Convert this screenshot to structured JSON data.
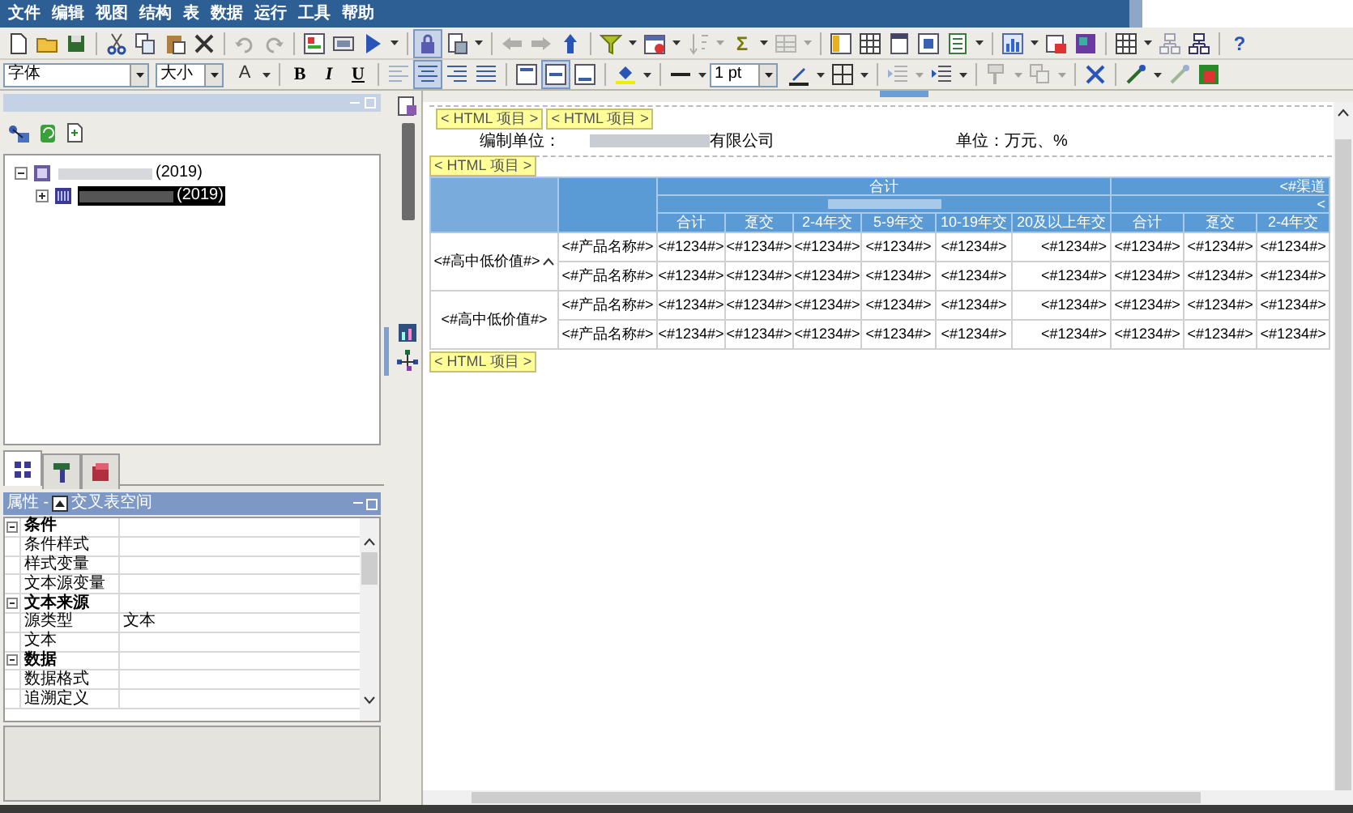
{
  "menu": [
    "文件",
    "编辑",
    "视图",
    "结构",
    "表",
    "数据",
    "运行",
    "工具",
    "帮助"
  ],
  "toolbar_1": [
    {
      "kind": "new",
      "pressed": false,
      "disabled": false
    },
    {
      "kind": "open",
      "pressed": false,
      "disabled": false
    },
    {
      "kind": "save",
      "pressed": false,
      "disabled": false
    },
    {
      "kind": "separator"
    },
    {
      "kind": "cut",
      "pressed": false,
      "disabled": false
    },
    {
      "kind": "copy",
      "pressed": false,
      "disabled": false
    },
    {
      "kind": "paste",
      "pressed": false,
      "disabled": false
    },
    {
      "kind": "delete",
      "pressed": false,
      "disabled": false
    },
    {
      "kind": "separator"
    },
    {
      "kind": "undo",
      "pressed": false,
      "disabled": true
    },
    {
      "kind": "redo",
      "pressed": false,
      "disabled": true
    },
    {
      "kind": "separator"
    },
    {
      "kind": "form",
      "pressed": false,
      "disabled": false
    },
    {
      "kind": "html",
      "pressed": false,
      "disabled": false
    },
    {
      "kind": "run",
      "pressed": false,
      "disabled": false
    },
    {
      "kind": "caret",
      "pressed": false,
      "disabled": false
    },
    {
      "kind": "separator"
    },
    {
      "kind": "lock",
      "pressed": true,
      "disabled": false
    },
    {
      "kind": "page",
      "pressed": false,
      "disabled": false
    },
    {
      "kind": "caret",
      "pressed": false,
      "disabled": false
    },
    {
      "kind": "separator"
    },
    {
      "kind": "back",
      "pressed": false,
      "disabled": true
    },
    {
      "kind": "forward",
      "pressed": false,
      "disabled": true
    },
    {
      "kind": "up",
      "pressed": false,
      "disabled": false
    },
    {
      "kind": "separator"
    },
    {
      "kind": "filter",
      "pressed": false,
      "disabled": false
    },
    {
      "kind": "caret",
      "pressed": false,
      "disabled": false
    },
    {
      "kind": "calendar",
      "pressed": false,
      "disabled": false
    },
    {
      "kind": "caret",
      "pressed": false,
      "disabled": false
    },
    {
      "kind": "sort",
      "pressed": false,
      "disabled": true
    },
    {
      "kind": "caret",
      "pressed": false,
      "disabled": true
    },
    {
      "kind": "sum",
      "label": "Σ",
      "pressed": false,
      "disabled": false
    },
    {
      "kind": "caret",
      "pressed": false,
      "disabled": false
    },
    {
      "kind": "grid",
      "pressed": false,
      "disabled": true
    },
    {
      "kind": "caret",
      "pressed": false,
      "disabled": true
    },
    {
      "kind": "separator"
    },
    {
      "kind": "column",
      "pressed": false,
      "disabled": false
    },
    {
      "kind": "table",
      "pressed": false,
      "disabled": false
    },
    {
      "kind": "header",
      "pressed": false,
      "disabled": false
    },
    {
      "kind": "frame",
      "pressed": false,
      "disabled": false
    },
    {
      "kind": "doc",
      "pressed": false,
      "disabled": false
    },
    {
      "kind": "caret",
      "pressed": false,
      "disabled": false
    },
    {
      "kind": "separator"
    },
    {
      "kind": "chart",
      "pressed": false,
      "disabled": false
    },
    {
      "kind": "caret",
      "pressed": false,
      "disabled": false
    },
    {
      "kind": "image",
      "pressed": false,
      "disabled": false
    },
    {
      "kind": "image2",
      "pressed": false,
      "disabled": false
    },
    {
      "kind": "separator"
    },
    {
      "kind": "table",
      "pressed": false,
      "disabled": false
    },
    {
      "kind": "caret",
      "pressed": false,
      "disabled": false
    },
    {
      "kind": "tree",
      "pressed": false,
      "disabled": true
    },
    {
      "kind": "tree",
      "pressed": false,
      "disabled": false
    },
    {
      "kind": "separator"
    },
    {
      "kind": "help",
      "label": "?",
      "pressed": false,
      "disabled": false
    }
  ],
  "font_field": {
    "value": "字体"
  },
  "size_field": {
    "value": "大小"
  },
  "toolbar_2a": [
    {
      "kind": "fontcolor",
      "label": "A",
      "pressed": false,
      "disabled": false
    },
    {
      "kind": "caret",
      "pressed": false,
      "disabled": false
    },
    {
      "kind": "separator"
    },
    {
      "kind": "bold",
      "label": "B",
      "pressed": false,
      "disabled": false
    },
    {
      "kind": "italic",
      "label": "I",
      "pressed": false,
      "disabled": false
    },
    {
      "kind": "underline",
      "label": "U",
      "pressed": false,
      "disabled": false
    },
    {
      "kind": "separator"
    },
    {
      "kind": "alignleft",
      "pressed": false,
      "disabled": true
    },
    {
      "kind": "aligncenter",
      "pressed": true,
      "disabled": false
    },
    {
      "kind": "alignright",
      "pressed": false,
      "disabled": false
    },
    {
      "kind": "justify",
      "pressed": false,
      "disabled": false
    },
    {
      "kind": "separator"
    },
    {
      "kind": "valigntop",
      "pressed": false,
      "disabled": false
    },
    {
      "kind": "valignmiddle",
      "pressed": true,
      "disabled": false
    },
    {
      "kind": "valignbottom",
      "pressed": false,
      "disabled": false
    },
    {
      "kind": "separator"
    },
    {
      "kind": "fill",
      "pressed": false,
      "disabled": false
    },
    {
      "kind": "caret",
      "pressed": false,
      "disabled": false
    },
    {
      "kind": "separator"
    },
    {
      "kind": "line",
      "pressed": false,
      "disabled": false
    },
    {
      "kind": "caret",
      "pressed": false,
      "disabled": false
    }
  ],
  "line_width_field": {
    "value": "1 pt"
  },
  "toolbar_2b": [
    {
      "kind": "pen",
      "pressed": false,
      "disabled": false
    },
    {
      "kind": "caret",
      "pressed": false,
      "disabled": false
    },
    {
      "kind": "borders",
      "pressed": false,
      "disabled": false
    },
    {
      "kind": "caret",
      "pressed": false,
      "disabled": false
    },
    {
      "kind": "separator"
    },
    {
      "kind": "indent",
      "pressed": false,
      "disabled": true
    },
    {
      "kind": "caret",
      "pressed": false,
      "disabled": true
    },
    {
      "kind": "indent",
      "pressed": false,
      "disabled": false
    },
    {
      "kind": "caret",
      "pressed": false,
      "disabled": false
    },
    {
      "kind": "separator"
    },
    {
      "kind": "brush",
      "pressed": false,
      "disabled": true
    },
    {
      "kind": "caret",
      "pressed": false,
      "disabled": true
    },
    {
      "kind": "copyformat",
      "pressed": false,
      "disabled": true
    },
    {
      "kind": "caret",
      "pressed": false,
      "disabled": true
    },
    {
      "kind": "separator"
    },
    {
      "kind": "tools",
      "pressed": false,
      "disabled": false
    },
    {
      "kind": "separator"
    },
    {
      "kind": "wand",
      "pressed": false,
      "disabled": false
    },
    {
      "kind": "caret",
      "pressed": false,
      "disabled": false
    },
    {
      "kind": "wand",
      "pressed": false,
      "disabled": true
    },
    {
      "kind": "excel",
      "pressed": false,
      "disabled": false
    }
  ],
  "tree": [
    {
      "label": "(2019)",
      "expanded": true,
      "selected": false,
      "children": [
        {
          "label": "(2019)",
          "expanded": false,
          "selected": true
        }
      ]
    }
  ],
  "panel_tabs": [
    {
      "kind": "variables",
      "selected": true
    },
    {
      "kind": "styles",
      "selected": false
    },
    {
      "kind": "gallery",
      "selected": false
    }
  ],
  "properties": {
    "title": "属性 -",
    "object": "交叉表空间",
    "rows": [
      {
        "kind": "category",
        "name": "条件",
        "expanded": true
      },
      {
        "kind": "property",
        "name": "条件样式"
      },
      {
        "kind": "property",
        "name": "样式变量"
      },
      {
        "kind": "property",
        "name": "文本源变量"
      },
      {
        "kind": "category",
        "name": "文本来源",
        "expanded": true
      },
      {
        "kind": "property",
        "name": "源类型",
        "value": "文本"
      },
      {
        "kind": "property",
        "name": "文本"
      },
      {
        "kind": "category",
        "name": "数据",
        "expanded": true
      },
      {
        "kind": "property",
        "name": "数据格式"
      },
      {
        "kind": "property",
        "name": "追溯定义"
      }
    ]
  },
  "report": {
    "top_chips": [
      "< HTML 项目 >",
      "< HTML 项目 >"
    ],
    "company_label": "编制单位：",
    "company_suffix": "有限公司",
    "unit": "单位：万元、%",
    "table_chip": "< HTML 项目 >",
    "bottom_chip": "< HTML 项目 >",
    "column_groups": [
      {
        "label": "合计",
        "columns": [
          "合计",
          "趸交",
          "2-4年交",
          "5-9年交",
          "10-19年交",
          "20及以上年交"
        ]
      },
      {
        "label": "<#渠道",
        "sublabel": "<",
        "columns": [
          "合计",
          "趸交",
          "2-4年交"
        ]
      }
    ],
    "row_groups": [
      {
        "label": "<#高中低价值#>",
        "flagged": true,
        "rows": [
          {
            "product": "<#产品名称#>",
            "cells": [
              "<#1234#>",
              "<#1234#>",
              "<#1234#>",
              "<#1234#>",
              "<#1234#>",
              "<#1234#>",
              "<#1234#>",
              "<#1234#>",
              "<#1234#>"
            ]
          },
          {
            "product": "<#产品名称#>",
            "cells": [
              "<#1234#>",
              "<#1234#>",
              "<#1234#>",
              "<#1234#>",
              "<#1234#>",
              "<#1234#>",
              "<#1234#>",
              "<#1234#>",
              "<#1234#>"
            ]
          }
        ]
      },
      {
        "label": "<#高中低价值#>",
        "flagged": false,
        "rows": [
          {
            "product": "<#产品名称#>",
            "cells": [
              "<#1234#>",
              "<#1234#>",
              "<#1234#>",
              "<#1234#>",
              "<#1234#>",
              "<#1234#>",
              "<#1234#>",
              "<#1234#>",
              "<#1234#>"
            ]
          },
          {
            "product": "<#产品名称#>",
            "cells": [
              "<#1234#>",
              "<#1234#>",
              "<#1234#>",
              "<#1234#>",
              "<#1234#>",
              "<#1234#>",
              "<#1234#>",
              "<#1234#>",
              "<#1234#>"
            ]
          }
        ]
      }
    ]
  }
}
